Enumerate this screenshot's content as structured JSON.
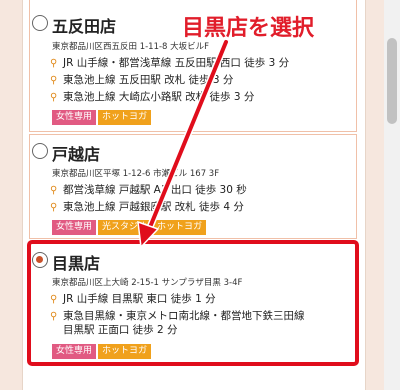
{
  "annotation": {
    "callout": "目黒店を選択",
    "accent_color": "#e00d1c"
  },
  "stores": [
    {
      "name": "五反田店",
      "address": "東京都品川区西五反田 1-11-8 大坂ビルF",
      "access": [
        "JR 山手線・都営浅草線 五反田駅 西口 徒歩 3 分",
        "東急池上線 五反田駅 改札 徒歩 3 分",
        "東急池上線 大崎広小路駅 改札 徒歩 3 分"
      ],
      "tags": [
        "女性専用",
        "ホットヨガ"
      ],
      "selected": false
    },
    {
      "name": "戸越店",
      "address": "東京都品川区平塚 1-12-6 市瀬ビル 167 3F",
      "access": [
        "都営浅草線 戸越駅 A1 出口 徒歩 30 秒",
        "東急池上線 戸越銀座駅 改札 徒歩 4 分"
      ],
      "tags": [
        "女性専用",
        "光スタジオ",
        "ホットヨガ"
      ],
      "selected": false
    },
    {
      "name": "目黒店",
      "address": "東京都品川区上大崎 2-15-1 サンプラザ目黒 3-4F",
      "access": [
        "JR 山手線 目黒駅 東口 徒歩 1 分",
        "東急目黒線・東京メトロ南北線・都営地下鉄三田線",
        "目黒駅 正面口 徒歩 2 分"
      ],
      "tags": [
        "女性専用",
        "ホットヨガ"
      ],
      "selected": true
    }
  ]
}
